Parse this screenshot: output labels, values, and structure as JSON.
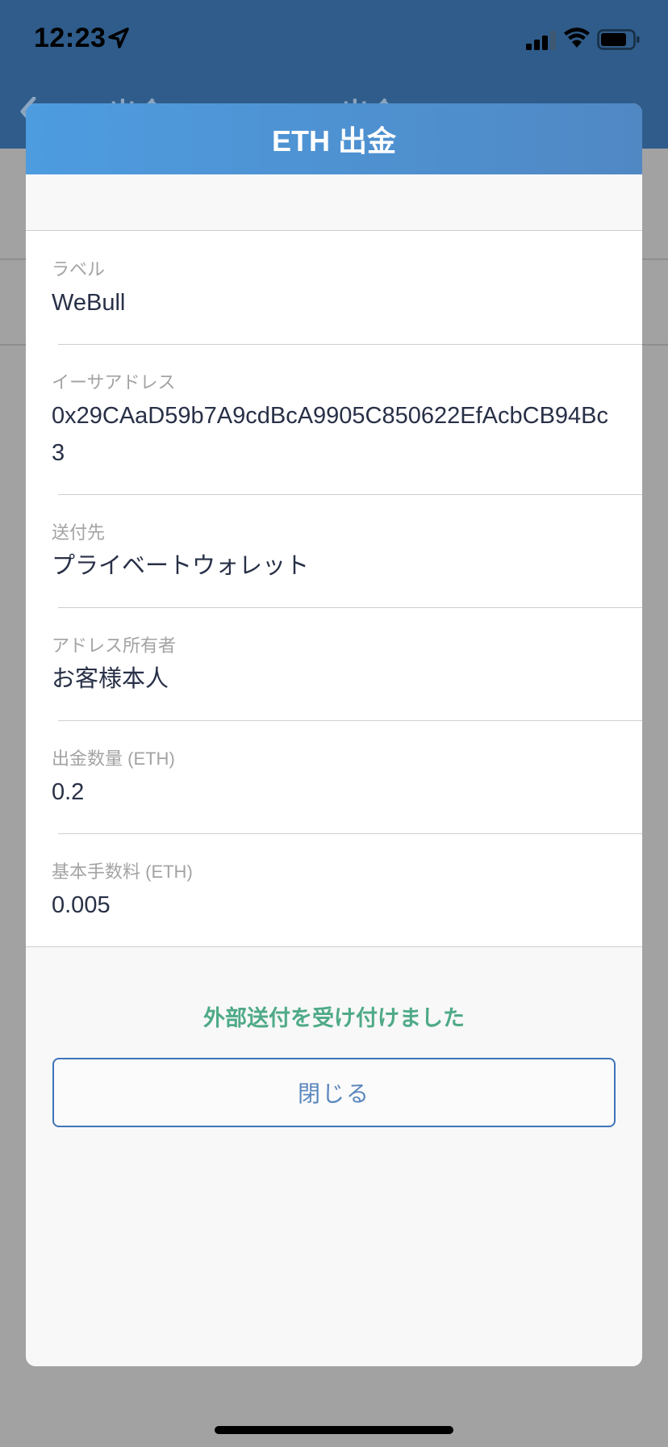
{
  "status_bar": {
    "time": "12:23"
  },
  "background": {
    "nav_back_label": "ETH 出金",
    "nav_title": "ETH 出金"
  },
  "modal": {
    "title": "ETH 出金",
    "details": [
      {
        "label": "ラベル",
        "value": "WeBull"
      },
      {
        "label": "イーサアドレス",
        "value": "0x29CAaD59b7A9cdBcA9905C850622EfAcbCB94Bc3"
      },
      {
        "label": "送付先",
        "value": "プライベートウォレット"
      },
      {
        "label": "アドレス所有者",
        "value": "お客様本人"
      },
      {
        "label": "出金数量 (ETH)",
        "value": "0.2"
      },
      {
        "label": "基本手数料 (ETH)",
        "value": "0.005"
      }
    ],
    "status_message": "外部送付を受け付けました",
    "close_label": "閉じる"
  },
  "colors": {
    "header_gradient_start": "#4d9ce0",
    "header_gradient_end": "#5088c4",
    "success_text": "#4faa87",
    "button_border": "#3f74b8"
  }
}
